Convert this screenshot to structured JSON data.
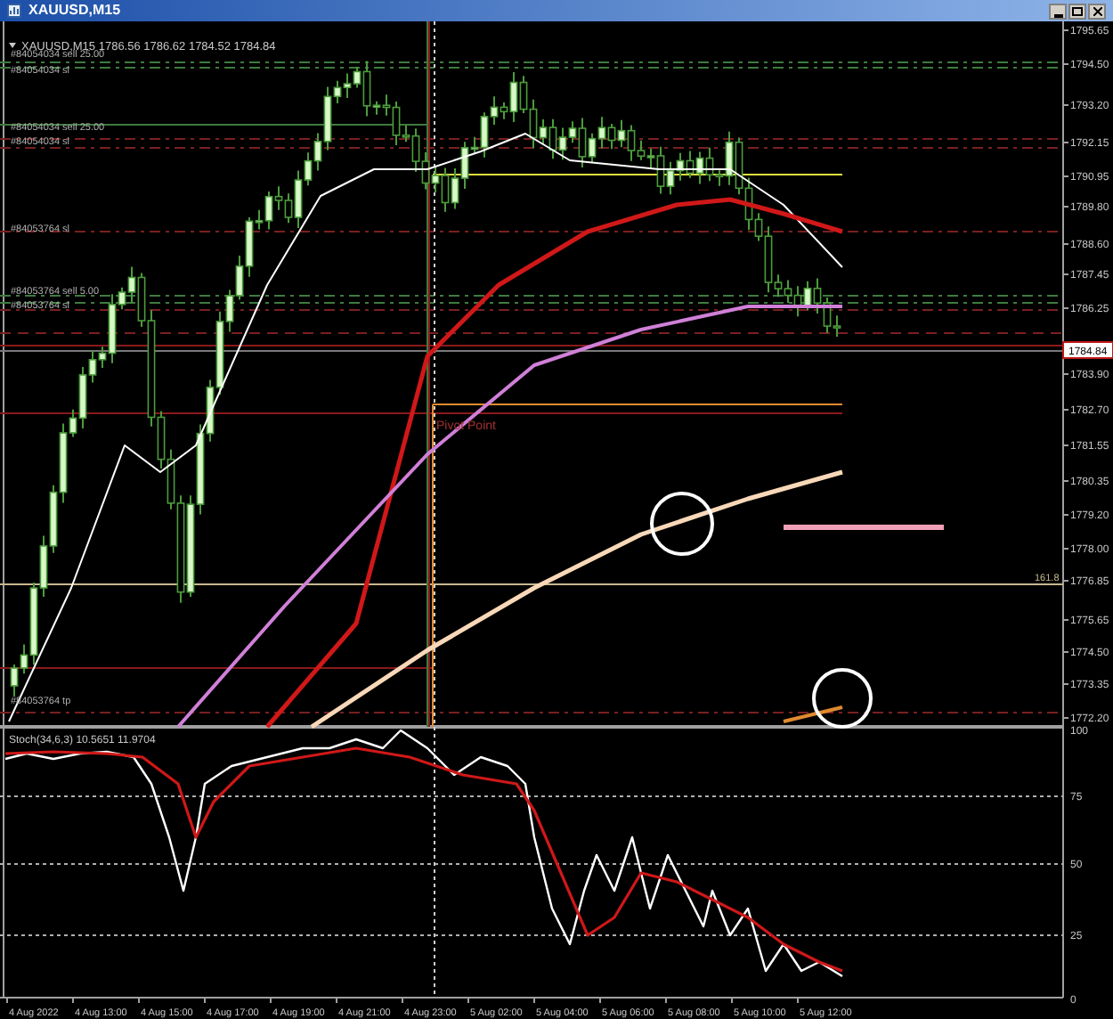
{
  "window": {
    "title": "XAUUSD,M15"
  },
  "chart_header": "XAUUSD,M15  1786.56 1786.62 1784.52 1784.84",
  "order_labels": [
    "#84054034 sell 25.00",
    "#84054034 sl",
    "#84054034 sell 25.00",
    "#84054034 sl",
    "#84053764 sl",
    "#84053764 sell 5.00",
    "#84053764 sl",
    "#84053764 tp"
  ],
  "pivot_label": "Pivot Point",
  "fib_label": "161.8",
  "price_axis": {
    "labels": [
      "1795.65",
      "1794.50",
      "1793.20",
      "1792.15",
      "1790.95",
      "1789.80",
      "1788.60",
      "1787.45",
      "1786.25",
      "1783.90",
      "1782.70",
      "1781.55",
      "1780.35",
      "1779.20",
      "1778.00",
      "1776.85",
      "1775.65",
      "1774.50",
      "1773.35",
      "1772.20"
    ],
    "current_price": "1784.84"
  },
  "indicator": {
    "label": "Stoch(34,6,3) 10.5651 11.9704",
    "levels": [
      "100",
      "75",
      "50",
      "25",
      "0"
    ]
  },
  "time_axis": [
    "4 Aug 2022",
    "4 Aug 13:00",
    "4 Aug 15:00",
    "4 Aug 17:00",
    "4 Aug 19:00",
    "4 Aug 21:00",
    "4 Aug 23:00",
    "5 Aug 02:00",
    "5 Aug 04:00",
    "5 Aug 06:00",
    "5 Aug 08:00",
    "5 Aug 10:00",
    "5 Aug 12:00"
  ]
}
